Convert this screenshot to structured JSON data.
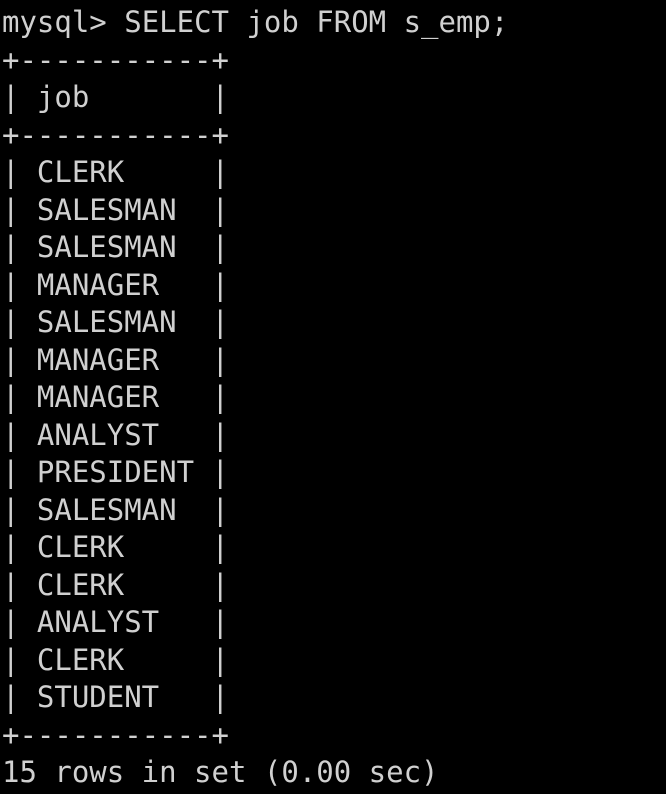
{
  "terminal": {
    "prompt": "mysql>",
    "command": "SELECT job FROM s_emp;",
    "border": "+-----------+",
    "header": "| job       |",
    "rows": [
      "| CLERK     |",
      "| SALESMAN  |",
      "| SALESMAN  |",
      "| MANAGER   |",
      "| SALESMAN  |",
      "| MANAGER   |",
      "| MANAGER   |",
      "| ANALYST   |",
      "| PRESIDENT |",
      "| SALESMAN  |",
      "| CLERK     |",
      "| CLERK     |",
      "| ANALYST   |",
      "| CLERK     |",
      "| STUDENT   |"
    ],
    "summary": "15 rows in set (0.00 sec)"
  }
}
